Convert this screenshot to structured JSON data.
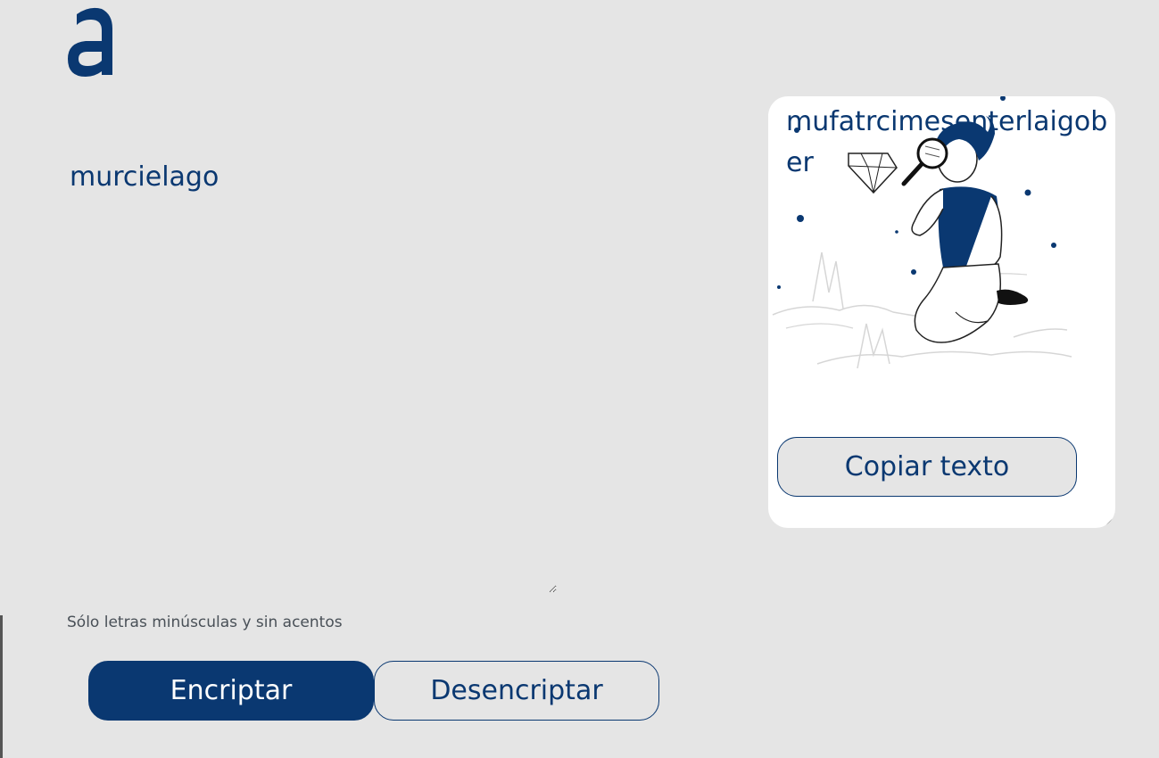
{
  "logo": {
    "icon": "alura-a-logo",
    "color": "#0A3871"
  },
  "input": {
    "value": "murcielago"
  },
  "hint": {
    "text": "Sólo letras minúsculas y sin acentos",
    "icon": "info-icon"
  },
  "buttons": {
    "encrypt_label": "Encriptar",
    "decrypt_label": "Desencriptar",
    "copy_label": "Copiar texto"
  },
  "output": {
    "text": "mufatrcimesenterlaigober",
    "illustration": "person-with-magnifying-glass-illustration"
  },
  "colors": {
    "primary": "#0A3871",
    "background": "#E5E5E5",
    "card": "#FFFFFF"
  }
}
